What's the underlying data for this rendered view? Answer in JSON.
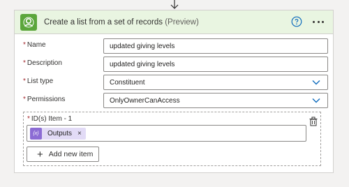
{
  "card": {
    "title": "Create a list from a set of records",
    "title_suffix": "(Preview)",
    "accent_color": "#5ba63b",
    "header_bg": "#e9f5e1"
  },
  "fields": {
    "name": {
      "label": "Name",
      "value": "updated giving levels"
    },
    "description": {
      "label": "Description",
      "value": "updated giving levels"
    },
    "list_type": {
      "label": "List type",
      "value": "Constituent"
    },
    "permissions": {
      "label": "Permissions",
      "value": "OnlyOwnerCanAccess"
    }
  },
  "ids": {
    "label": "ID(s) Item - 1",
    "token_label": "Outputs",
    "token_icon_text": "{x}",
    "token_close": "×",
    "add_button_label": "Add new item",
    "add_button_icon": "+"
  },
  "required_marker": "*",
  "icons": [
    "arrow-down-icon",
    "connector-logo-icon",
    "help-icon",
    "more-options-icon",
    "chevron-down-icon",
    "delete-icon",
    "expression-icon",
    "plus-icon"
  ]
}
